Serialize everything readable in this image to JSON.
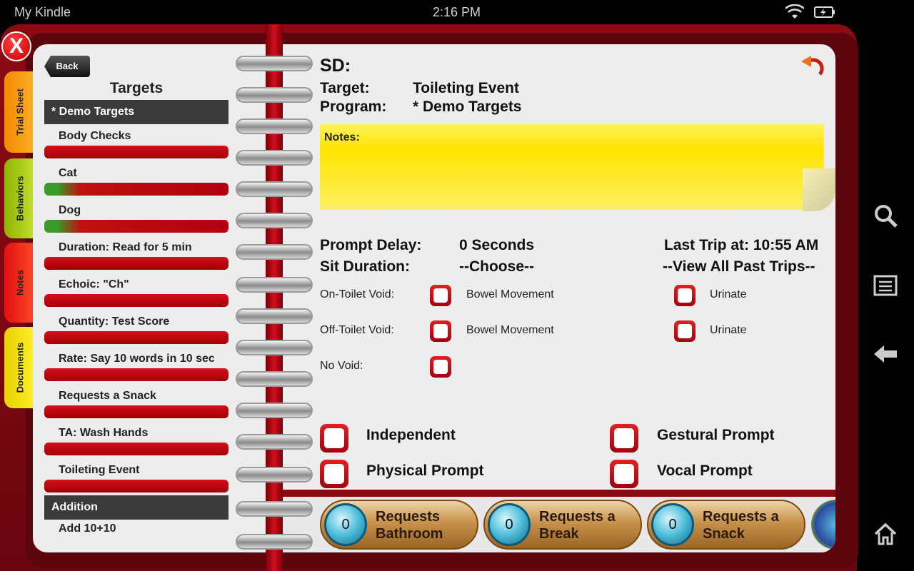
{
  "status_bar": {
    "title": "My Kindle",
    "time": "2:16 PM"
  },
  "close_label": "X",
  "tabs": [
    "Trial Sheet",
    "Behaviors",
    "Notes",
    "Documents"
  ],
  "left": {
    "back": "Back",
    "title": "Targets",
    "group1": "* Demo Targets",
    "items": [
      "Body Checks",
      "Cat",
      "Dog",
      "Duration: Read for 5 min",
      "Echoic: \"Ch\"",
      "Quantity: Test Score",
      "Rate: Say 10 words in 10 sec",
      "Requests a Snack",
      "TA: Wash Hands",
      "Toileting Event"
    ],
    "group2": "Addition",
    "group2_item": "Add 10+10"
  },
  "right": {
    "sd": "SD:",
    "target_label": "Target:",
    "target_value": "Toileting Event",
    "program_label": "Program:",
    "program_value": "* Demo Targets",
    "notes_label": "Notes:",
    "prompt_delay_label": "Prompt Delay:",
    "prompt_delay_value": "0 Seconds",
    "last_trip": "Last Trip at: 10:55 AM",
    "sit_duration_label": "Sit Duration:",
    "sit_duration_value": "--Choose--",
    "view_all": "--View All Past Trips--",
    "on_toilet": "On-Toilet Void:",
    "off_toilet": "Off-Toilet Void:",
    "no_void": "No Void:",
    "bowel": "Bowel Movement",
    "urinate": "Urinate",
    "prompts": [
      "Independent",
      "Gestural Prompt",
      "Physical Prompt",
      "Vocal Prompt"
    ],
    "counters": [
      {
        "count": "0",
        "label": "Requests Bathroom"
      },
      {
        "count": "0",
        "label": "Requests a Break"
      },
      {
        "count": "0",
        "label": "Requests a Snack"
      }
    ]
  }
}
